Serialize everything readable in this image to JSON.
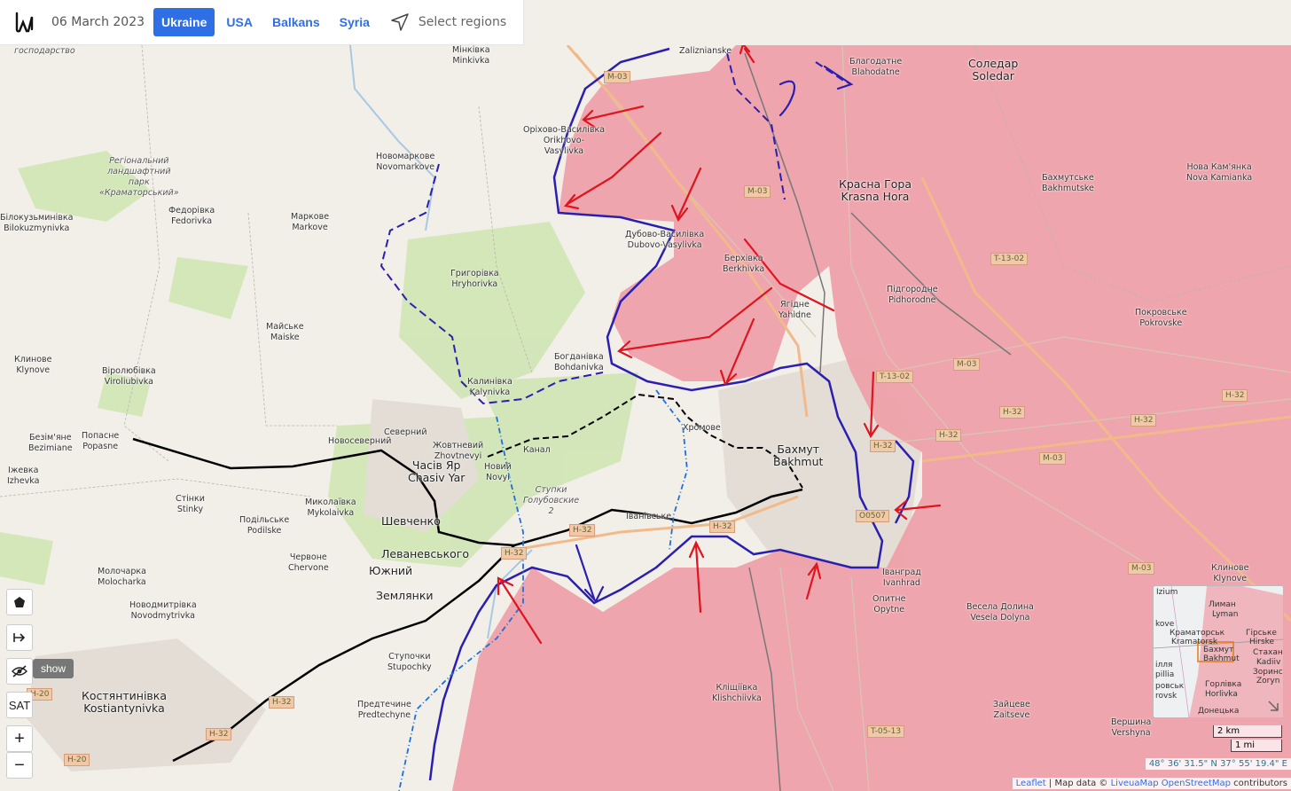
{
  "header": {
    "date": "06 March 2023",
    "tabs": [
      {
        "label": "Ukraine",
        "active": true
      },
      {
        "label": "USA",
        "active": false
      },
      {
        "label": "Balkans",
        "active": false
      },
      {
        "label": "Syria",
        "active": false
      }
    ],
    "select_regions": "Select regions"
  },
  "colors": {
    "occupied_area": "#ef9ea7",
    "frontline_blue": "#2a1fb0",
    "attack_arrow": "#e0141e",
    "ukr_line": "#000000",
    "background": "#f2efe9"
  },
  "places": {
    "gosudarstvo": "господарство",
    "minkivka": [
      "Мінківка",
      "Minkivka"
    ],
    "zalizianske": "Zaliznianske",
    "blahodatne": [
      "Благодатне",
      "Blahodatne"
    ],
    "soledar": [
      "Соледар",
      "Soledar"
    ],
    "orikhovo": [
      "Оріхово-Василівка",
      "Orikhovo-",
      "Vasylivka"
    ],
    "novomarkove": [
      "Новомаркове",
      "Novomarkove"
    ],
    "park": [
      "Регіональний",
      "ландшафтний",
      "парк",
      "«Краматорський»"
    ],
    "fedorivka": [
      "Федорівка",
      "Fedorivka"
    ],
    "markove": [
      "Маркове",
      "Markove"
    ],
    "bilokuzmynivka": [
      "Білокузьминівка",
      "Bilokuzmynivka"
    ],
    "krasna_hora": [
      "Красна Гора",
      "Krasna Hora"
    ],
    "bakhmutske": [
      "Бахмутське",
      "Bakhmutske"
    ],
    "nova_kamianka": [
      "Нова Кам'янка",
      "Nova Kamianka"
    ],
    "dubovo": [
      "Дубово-Василівка",
      "Dubovo-Vasylivka"
    ],
    "berkhivka": [
      "Берхівка",
      "Berkhivka"
    ],
    "hryhorivka": [
      "Григорівка",
      "Hryhorivka"
    ],
    "pidhorodne": [
      "Підгородне",
      "Pidhorodne"
    ],
    "yahidne": [
      "Ягідне",
      "Yahidne"
    ],
    "pokrovske": [
      "Покровське",
      "Pokrovske"
    ],
    "maiske": [
      "Майське",
      "Maiske"
    ],
    "klynove": [
      "Клинове",
      "Klynove"
    ],
    "viroliubivka": [
      "Віролюбівка",
      "Viroliubivka"
    ],
    "bohdanivka": [
      "Богданівка",
      "Bohdanivka"
    ],
    "kalynivka": [
      "Калинівка",
      "Kalynivka"
    ],
    "khromove": "Хромове",
    "bakhmut": [
      "Бахмут",
      "Bakhmut"
    ],
    "bezimiane": [
      "Безім'яне",
      "Bezimiane"
    ],
    "popasne": [
      "Попасне",
      "Popasne"
    ],
    "novosvernyi": "Новосеверний",
    "severnyi": "Северний",
    "zhovtnevyi": [
      "Жовтневий",
      "Zhovtnevyi"
    ],
    "chasiv_yar": [
      "Часів Яр",
      "Chasiv Yar"
    ],
    "kanal": "Канал",
    "novyi": [
      "Новий",
      "Novyi"
    ],
    "stupki": [
      "Ступки",
      "Голубовские",
      "2"
    ],
    "izhevka": [
      "Іжевка",
      "Izhevka"
    ],
    "stinky": [
      "Стінки",
      "Stinky"
    ],
    "mykolaivka": [
      "Миколаївка",
      "Mykolaivka"
    ],
    "shevchenko": "Шевченко",
    "ivanivske": "Іванівське",
    "podilske": [
      "Подільське",
      "Podilske"
    ],
    "levanevskoho": "Леваневського",
    "chervone": [
      "Червоне",
      "Chervone"
    ],
    "yuzhnyi": "Южний",
    "molocharka": [
      "Молочарка",
      "Molocharka"
    ],
    "zemlianky": "Землянки",
    "ivanhrad": [
      "Іванград",
      "Ivanhrad"
    ],
    "opytne": [
      "Опитне",
      "Opytne"
    ],
    "vesela_dolyna": [
      "Весела Долина",
      "Vesela Dolyna"
    ],
    "novodmytrivka": [
      "Новодмитрівка",
      "Novodmytrivka"
    ],
    "stupochky": [
      "Ступочки",
      "Stupochky"
    ],
    "kostiantynivka": [
      "Костянтинівка",
      "Kostiantynivka"
    ],
    "predtechyne": [
      "Предтечине",
      "Predtechyne"
    ],
    "klishchiivka": [
      "Кліщіївка",
      "Klishchiivka"
    ],
    "zaitseve": [
      "Зайцеве",
      "Zaitseve"
    ],
    "vershyna": [
      "Вершина",
      "Vershyna"
    ],
    "klynove_e": [
      "Клинове",
      "Klynove"
    ]
  },
  "road_signs": [
    "M-03",
    "M-03",
    "T-13-02",
    "M-03",
    "T-13-02",
    "H-32",
    "H-32",
    "H-32",
    "H-32",
    "M-03",
    "H-32",
    "O0507",
    "H-32",
    "H-32",
    "H-32",
    "M-03",
    "T-05-13",
    "H-20",
    "H-32",
    "H-20",
    "H-32"
  ],
  "controls": {
    "sat": "SAT",
    "zoom_in": "+",
    "zoom_out": "−",
    "show": "show"
  },
  "minimap": {
    "labels": [
      "Izium",
      "Лиман",
      "Lyman",
      "kove",
      "Краматорськ",
      "Kramatorsk",
      "Гірське",
      "Hirske",
      "Бахмут",
      "Bakhmut",
      "Стахан",
      "Kadiiv",
      "Зоринс",
      "Zoryn",
      "ілля",
      "pillia",
      "ровськ",
      "rovsk",
      "Горлівка",
      "Horlivka",
      "Донецька"
    ]
  },
  "scale": [
    "2 km",
    "1 mi"
  ],
  "coords": "48° 36' 31.5\" N 37° 55' 19.4\" E",
  "attribution": {
    "leaflet": "Leaflet",
    "sep": " | Map data © ",
    "liveua": "LiveuaMap",
    "osm": "OpenStreetMap",
    "tail": " contributors"
  }
}
